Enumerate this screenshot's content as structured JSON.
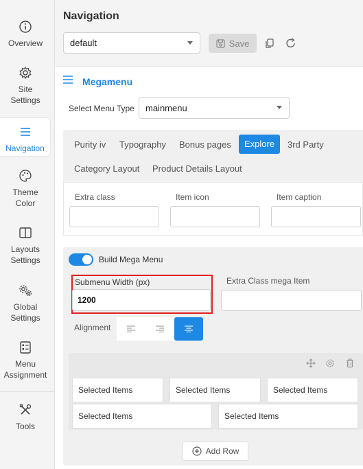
{
  "sidebar": {
    "items": [
      {
        "label": "Overview",
        "icon": "info-circle-icon"
      },
      {
        "label": "Site Settings",
        "icon": "gear-icon"
      },
      {
        "label": "Navigation",
        "icon": "hamburger-icon"
      },
      {
        "label": "Theme Color",
        "icon": "palette-icon"
      },
      {
        "label": "Layouts Settings",
        "icon": "columns-icon"
      },
      {
        "label": "Global Settings",
        "icon": "gears-icon"
      },
      {
        "label": "Menu Assignment",
        "icon": "checklist-icon"
      },
      {
        "label": "Tools",
        "icon": "tools-icon"
      }
    ],
    "active": "Navigation"
  },
  "header": {
    "title": "Navigation",
    "preset_value": "default",
    "save_label": "Save"
  },
  "megamenu": {
    "title": "Megamenu",
    "menu_type_label": "Select Menu Type",
    "menu_type_value": "mainmenu",
    "tabs": [
      "Purity iv",
      "Typography",
      "Bonus pages",
      "Explore",
      "3rd Party",
      "Category Layout",
      "Product Details Layout"
    ],
    "active_tab": "Explore",
    "fields": {
      "extra_class_label": "Extra class",
      "item_icon_label": "Item icon",
      "item_caption_label": "Item caption",
      "extra_class_value": "",
      "item_icon_value": "",
      "item_caption_value": ""
    },
    "build_mega_menu_label": "Build Mega Menu",
    "build_mega_menu_on": true,
    "submenu_width_label": "Submenu Width (px)",
    "submenu_width_value": "1200",
    "extra_class_mega_label": "Extra Class mega Item",
    "extra_class_mega_value": "",
    "alignment_label": "Alignment",
    "alignment_selected": "center",
    "rows": [
      [
        "Selected Items",
        "Selected Items",
        "Selected Items"
      ],
      [
        "Selected Items",
        "Selected Items"
      ]
    ],
    "add_row_label": "Add Row"
  },
  "colors": {
    "accent": "#1e88e5",
    "highlight": "#e0201f"
  }
}
